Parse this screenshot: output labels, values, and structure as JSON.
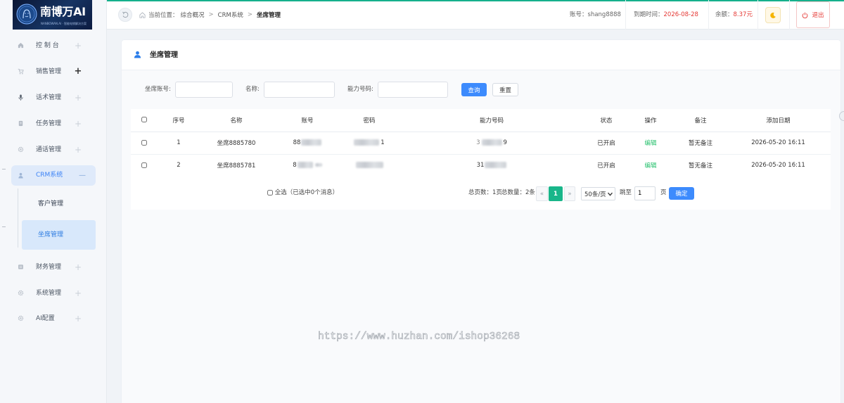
{
  "brand": {
    "name": "南博万AI",
    "tagline": "NANBOWAN.AI · 智能电销解决方案",
    "emblem_icon": "ai-face-icon"
  },
  "sidebar": {
    "items": [
      {
        "label": "控 制 台",
        "icon": "home-icon",
        "toggle": "+"
      },
      {
        "label": "销售管理",
        "icon": "cart-icon",
        "toggle": "+"
      },
      {
        "label": "话术管理",
        "icon": "mic-icon",
        "toggle": "+"
      },
      {
        "label": "任务管理",
        "icon": "document-icon",
        "toggle": "+"
      },
      {
        "label": "通话管理",
        "icon": "gear-icon",
        "toggle": "+"
      },
      {
        "label": "CRM系统",
        "icon": "user-icon",
        "toggle": "—",
        "expanded": true,
        "children": [
          {
            "label": "客户管理"
          },
          {
            "label": "坐席管理",
            "active": true
          }
        ]
      },
      {
        "label": "财务管理",
        "icon": "ledger-icon",
        "toggle": "+"
      },
      {
        "label": "系统管理",
        "icon": "gear-icon",
        "toggle": "+"
      },
      {
        "label": "AI配置",
        "icon": "gear-icon",
        "toggle": "+"
      }
    ]
  },
  "header": {
    "back_icon": "back-icon",
    "home_icon": "home-icon",
    "location_label": "当前位置：",
    "breadcrumb": [
      "综合概况",
      "CRM系统",
      "坐席管理"
    ],
    "breadcrumb_sep": ">",
    "account_label": "账号：",
    "account_value": "shang8888",
    "expire_label": "到期时间：",
    "expire_value": "2026-08-28",
    "balance_label": "余额：",
    "balance_value": "8.37元",
    "theme_icon": "moon-icon",
    "logout_icon": "power-icon",
    "logout_label": "退出"
  },
  "page": {
    "title": "坐席管理",
    "title_icon": "user-icon"
  },
  "filters": {
    "account_label": "坐席账号:",
    "name_label": "名称:",
    "number_label": "能力号码:",
    "search_label": "查询",
    "reset_label": "重置"
  },
  "table": {
    "columns": [
      "序号",
      "名称",
      "账号",
      "密码",
      "能力号码",
      "状态",
      "操作",
      "备注",
      "添加日期"
    ],
    "rows": [
      {
        "index": "1",
        "name": "坐席8885780",
        "account": {
          "prefix": "88",
          "masked": true
        },
        "password": {
          "suffix": "1",
          "masked": true
        },
        "number": {
          "prefix": "3",
          "suffix": "9",
          "masked": true
        },
        "status": "已开启",
        "action": "编辑",
        "remark": "暂无备注",
        "created": "2026-05-20 16:11"
      },
      {
        "index": "2",
        "name": "坐席8885781",
        "account": {
          "prefix": "8",
          "masked": true
        },
        "password": {
          "masked": true
        },
        "number": {
          "prefix": "31",
          "masked": true
        },
        "status": "已开启",
        "action": "编辑",
        "remark": "暂无备注",
        "created": "2026-05-20 16:11"
      }
    ]
  },
  "pagination": {
    "select_all_label": "全选（已选中0个消息）",
    "total_pages": "总页数：1页",
    "total_count": "总数量：2条",
    "prev": "«",
    "current": "1",
    "next": "»",
    "page_size": "50条/页",
    "jump_label": "跳至",
    "jump_value": "1",
    "page_unit": "页",
    "confirm_label": "确定"
  },
  "watermark": "https://www.huzhan.com/ishop36268",
  "colors": {
    "brand_green": "#15b08c",
    "accent_blue": "#3d8bfd",
    "active_nav_text": "#2f7de1",
    "danger_red": "#e53935",
    "edit_green": "#22bf6a",
    "logo_navy": "#0a1533"
  }
}
